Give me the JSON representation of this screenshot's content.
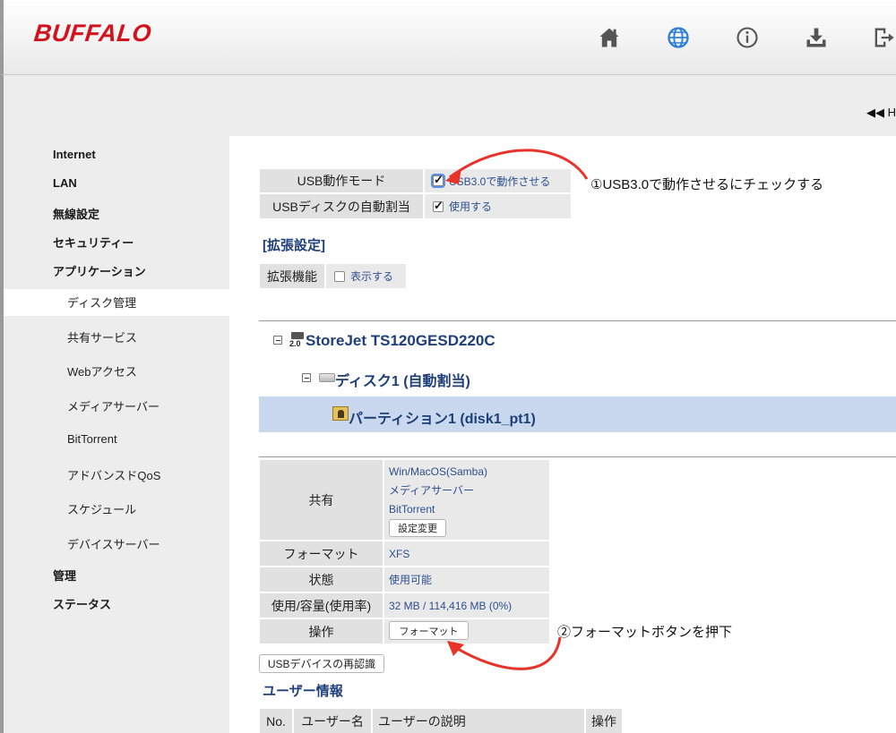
{
  "header": {
    "logo": "BUFFALO",
    "icons": [
      "home-icon",
      "globe-icon",
      "info-icon",
      "download-icon",
      "logout-icon"
    ]
  },
  "subbar": {
    "home_link": "◀◀ H"
  },
  "sidebar": {
    "items": [
      {
        "label": "Internet"
      },
      {
        "label": "LAN"
      },
      {
        "label": "無線設定"
      },
      {
        "label": "セキュリティー"
      },
      {
        "label": "アプリケーション"
      }
    ],
    "subitems": [
      {
        "label": "ディスク管理",
        "active": true
      },
      {
        "label": "共有サービス"
      },
      {
        "label": "Webアクセス"
      },
      {
        "label": "メディアサーバー"
      },
      {
        "label": "BitTorrent"
      },
      {
        "label": "アドバンスドQoS"
      },
      {
        "label": "スケジュール"
      },
      {
        "label": "デバイスサーバー"
      }
    ],
    "bottom_items": [
      {
        "label": "管理"
      },
      {
        "label": "ステータス"
      }
    ]
  },
  "usb": {
    "mode_label": "USB動作モード",
    "mode_value": "USB3.0で動作させる",
    "mode_checked": true,
    "auto_label": "USBディスクの自動割当",
    "auto_value": "使用する",
    "auto_checked": true
  },
  "extended": {
    "title": "[拡張設定]",
    "label": "拡張機能",
    "value": "表示する",
    "checked": false
  },
  "tree": {
    "device_badge": "2.0",
    "device": "StoreJet TS120GESD220C",
    "disk": "ディスク1 (自動割当)",
    "partition": "パーティション1 (disk1_pt1)"
  },
  "details": {
    "share_label": "共有",
    "share_values": [
      "Win/MacOS(Samba)",
      "メディアサーバー",
      "BitTorrent"
    ],
    "change_button": "設定変更",
    "format_label": "フォーマット",
    "format_value": "XFS",
    "status_label": "状態",
    "status_value": "使用可能",
    "usage_label": "使用/容量(使用率)",
    "usage_value": "32 MB / 114,416 MB (0%)",
    "op_label": "操作",
    "format_button": "フォーマット"
  },
  "recognize_button": "USBデバイスの再認識",
  "users": {
    "title": "ユーザー情報",
    "columns": [
      "No.",
      "ユーザー名",
      "ユーザーの説明",
      "操作"
    ]
  },
  "annotations": {
    "step1": "①USB3.0で動作させるにチェックする",
    "step2": "②フォーマットボタンを押下"
  },
  "colors": {
    "brand": "#d4121c",
    "link": "#1f3f7a",
    "accent_arrow": "#e8332a",
    "selected_row": "#c9d8ee"
  }
}
